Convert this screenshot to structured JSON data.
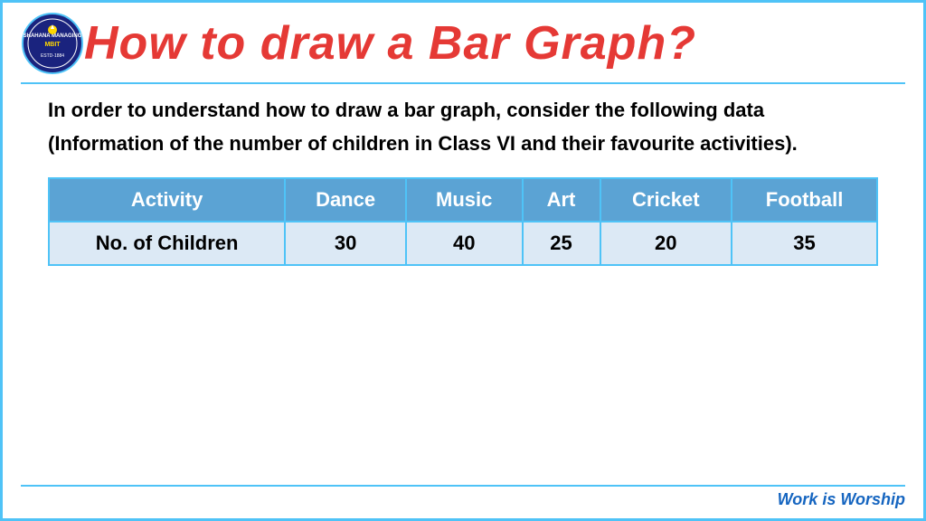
{
  "header": {
    "title": "How to draw a Bar Graph?"
  },
  "body": {
    "paragraph": "In order to understand how to draw a bar graph, consider the following data (Information of the number of children in Class VI and their favourite activities)."
  },
  "table": {
    "columns": [
      "Activity",
      "Dance",
      "Music",
      "Art",
      "Cricket",
      "Football"
    ],
    "rows": [
      {
        "label": "No. of Children",
        "values": [
          "30",
          "40",
          "25",
          "20",
          "35"
        ]
      }
    ]
  },
  "footer": {
    "text": "Work is Worship"
  }
}
